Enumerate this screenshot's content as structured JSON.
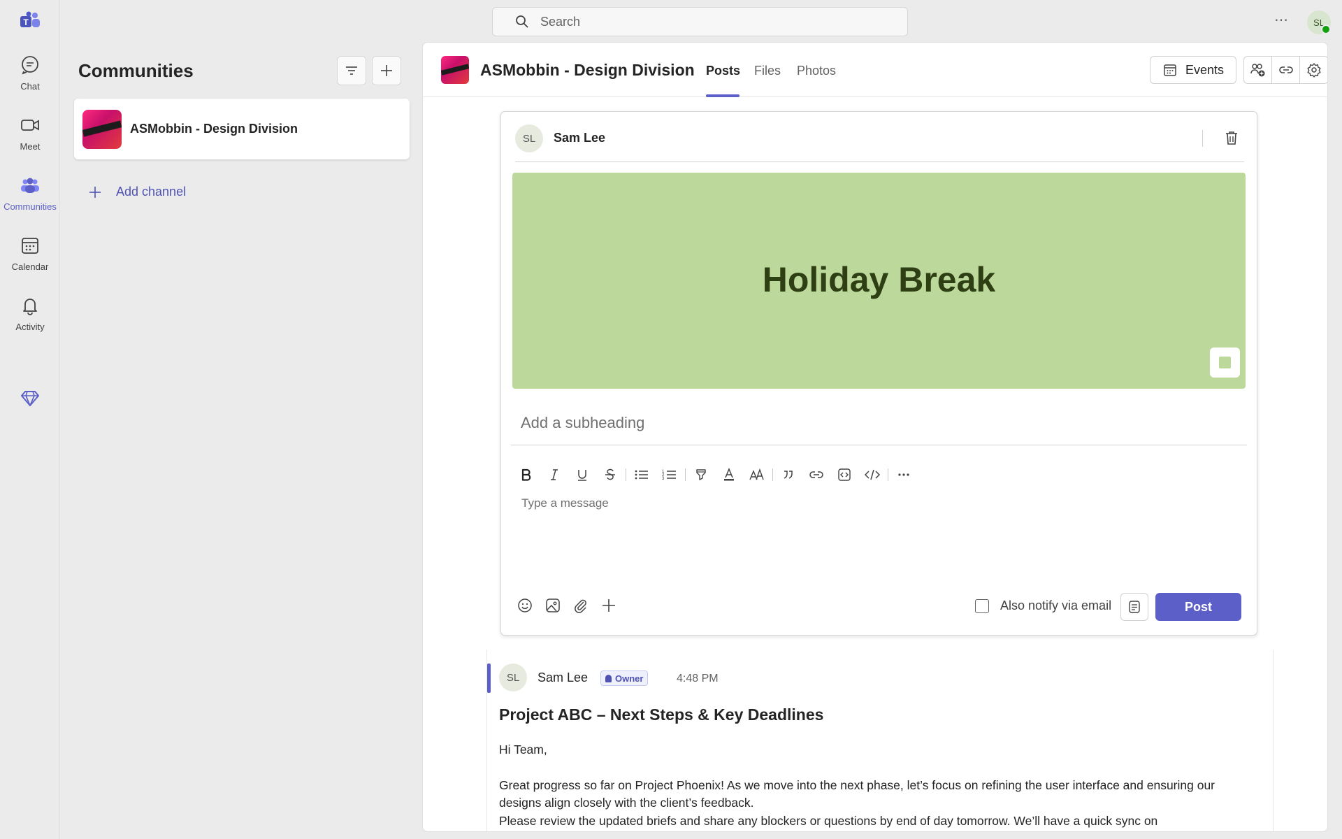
{
  "rail": {
    "items": [
      {
        "label": "Chat",
        "icon": "chat-icon"
      },
      {
        "label": "Meet",
        "icon": "video-icon"
      },
      {
        "label": "Communities",
        "icon": "communities-icon",
        "active": true
      },
      {
        "label": "Calendar",
        "icon": "calendar-icon"
      },
      {
        "label": "Activity",
        "icon": "bell-icon"
      }
    ]
  },
  "search": {
    "placeholder": "Search"
  },
  "user": {
    "initials": "SL",
    "status": "available"
  },
  "panel": {
    "title": "Communities",
    "community_name": "ASMobbin - Design Division",
    "add_channel_label": "Add channel"
  },
  "header": {
    "title": "ASMobbin - Design Division",
    "tabs": [
      "Posts",
      "Files",
      "Photos"
    ],
    "active_tab": "Posts",
    "events_label": "Events"
  },
  "composer": {
    "author_initials": "SL",
    "author": "Sam Lee",
    "banner_title": "Holiday Break",
    "banner_color": "#bcd99b",
    "subheading_placeholder": "Add a subheading",
    "message_placeholder": "Type a message",
    "notify_label": "Also notify via email",
    "post_label": "Post"
  },
  "post": {
    "author_initials": "SL",
    "author": "Sam Lee",
    "badge": "Owner",
    "time": "4:48 PM",
    "title": "Project ABC – Next Steps & Key Deadlines",
    "greeting": "Hi Team,",
    "body_line_1": "Great progress so far on Project Phoenix! As we move into the next phase, let’s focus on refining the user interface and ensuring our designs align closely with the client’s feedback.",
    "body_line_2": "Please review the updated briefs and share any blockers or questions by end of day tomorrow. We’ll have a quick sync on"
  },
  "colors": {
    "accent": "#5b5fc7",
    "background": "#ebebeb"
  }
}
